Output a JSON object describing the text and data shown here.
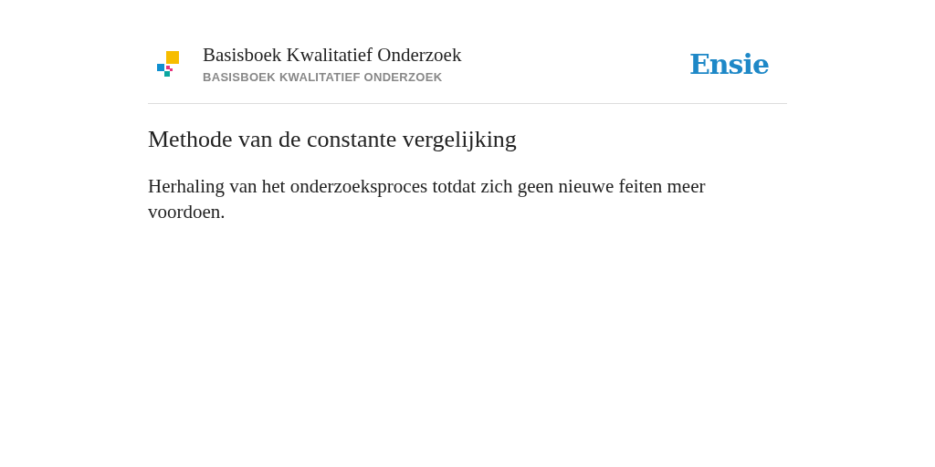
{
  "header": {
    "book_title": "Basisboek Kwalitatief Onderzoek",
    "book_subtitle": "BASISBOEK KWALITATIEF ONDERZOEK",
    "brand": "Ensie"
  },
  "entry": {
    "title": "Methode van de constante vergelijking",
    "definition": "Herhaling van het onderzoeksproces totdat zich geen nieuwe feiten meer voordoen."
  }
}
